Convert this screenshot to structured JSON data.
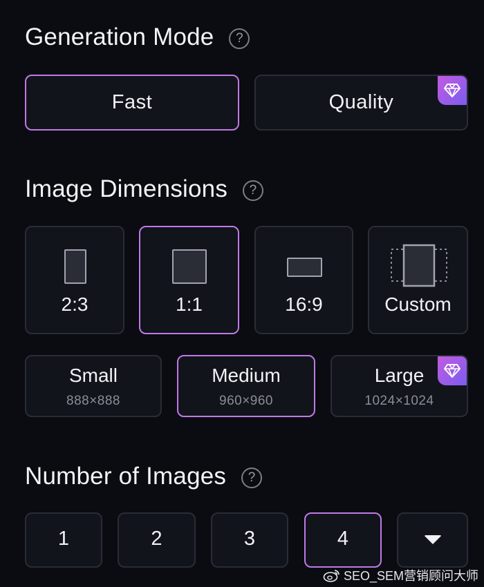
{
  "generation_mode": {
    "title": "Generation Mode",
    "help_glyph": "?",
    "options": [
      {
        "label": "Fast",
        "selected": true,
        "premium": false
      },
      {
        "label": "Quality",
        "selected": false,
        "premium": true
      }
    ]
  },
  "image_dimensions": {
    "title": "Image Dimensions",
    "help_glyph": "?",
    "ratios": [
      {
        "label": "2:3",
        "selected": false
      },
      {
        "label": "1:1",
        "selected": true
      },
      {
        "label": "16:9",
        "selected": false
      },
      {
        "label": "Custom",
        "selected": false
      }
    ],
    "sizes": [
      {
        "name": "Small",
        "pixels": "888×888",
        "selected": false,
        "premium": false
      },
      {
        "name": "Medium",
        "pixels": "960×960",
        "selected": true,
        "premium": false
      },
      {
        "name": "Large",
        "pixels": "1024×1024",
        "selected": false,
        "premium": true
      }
    ]
  },
  "number_of_images": {
    "title": "Number of Images",
    "help_glyph": "?",
    "options": [
      {
        "label": "1",
        "selected": false
      },
      {
        "label": "2",
        "selected": false
      },
      {
        "label": "3",
        "selected": false
      },
      {
        "label": "4",
        "selected": true
      }
    ],
    "more_icon": "caret-down-icon"
  },
  "watermark": {
    "text": "SEO_SEM营销顾问大师"
  },
  "colors": {
    "background": "#0b0c12",
    "card": "#12141c",
    "card_border": "#2a2c36",
    "selected_border": "#c07ae6",
    "premium_gradient_start": "#c25be0",
    "premium_gradient_end": "#7b5cf0"
  },
  "icons": {
    "help": "question-circle-icon",
    "premium": "diamond-icon"
  }
}
